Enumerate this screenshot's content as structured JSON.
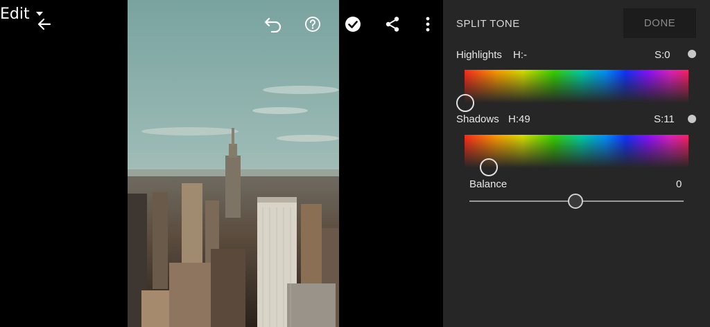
{
  "toolbar": {
    "back_icon": "arrow-left-icon",
    "edit_label": "Edit",
    "edit_dropdown_icon": "caret-down-icon",
    "undo_icon": "undo-icon",
    "help_icon": "help-circle-icon",
    "apply_icon": "check-circle-icon",
    "share_icon": "share-icon",
    "more_icon": "more-vertical-icon"
  },
  "panel": {
    "title": "SPLIT TONE",
    "done_label": "DONE",
    "highlights": {
      "label": "Highlights",
      "hue_text": "H:-",
      "saturation_text": "S:0",
      "hue_value": null,
      "saturation_value": 0
    },
    "shadows": {
      "label": "Shadows",
      "hue_text": "H:49",
      "saturation_text": "S:11",
      "hue_value": 49,
      "saturation_value": 11
    },
    "balance": {
      "label": "Balance",
      "value_text": "0",
      "value": 0
    }
  },
  "colors": {
    "panel_bg": "#262626",
    "done_bg": "#1c1c1c",
    "text": "#e8e8e8",
    "muted": "#8a8a8a"
  }
}
